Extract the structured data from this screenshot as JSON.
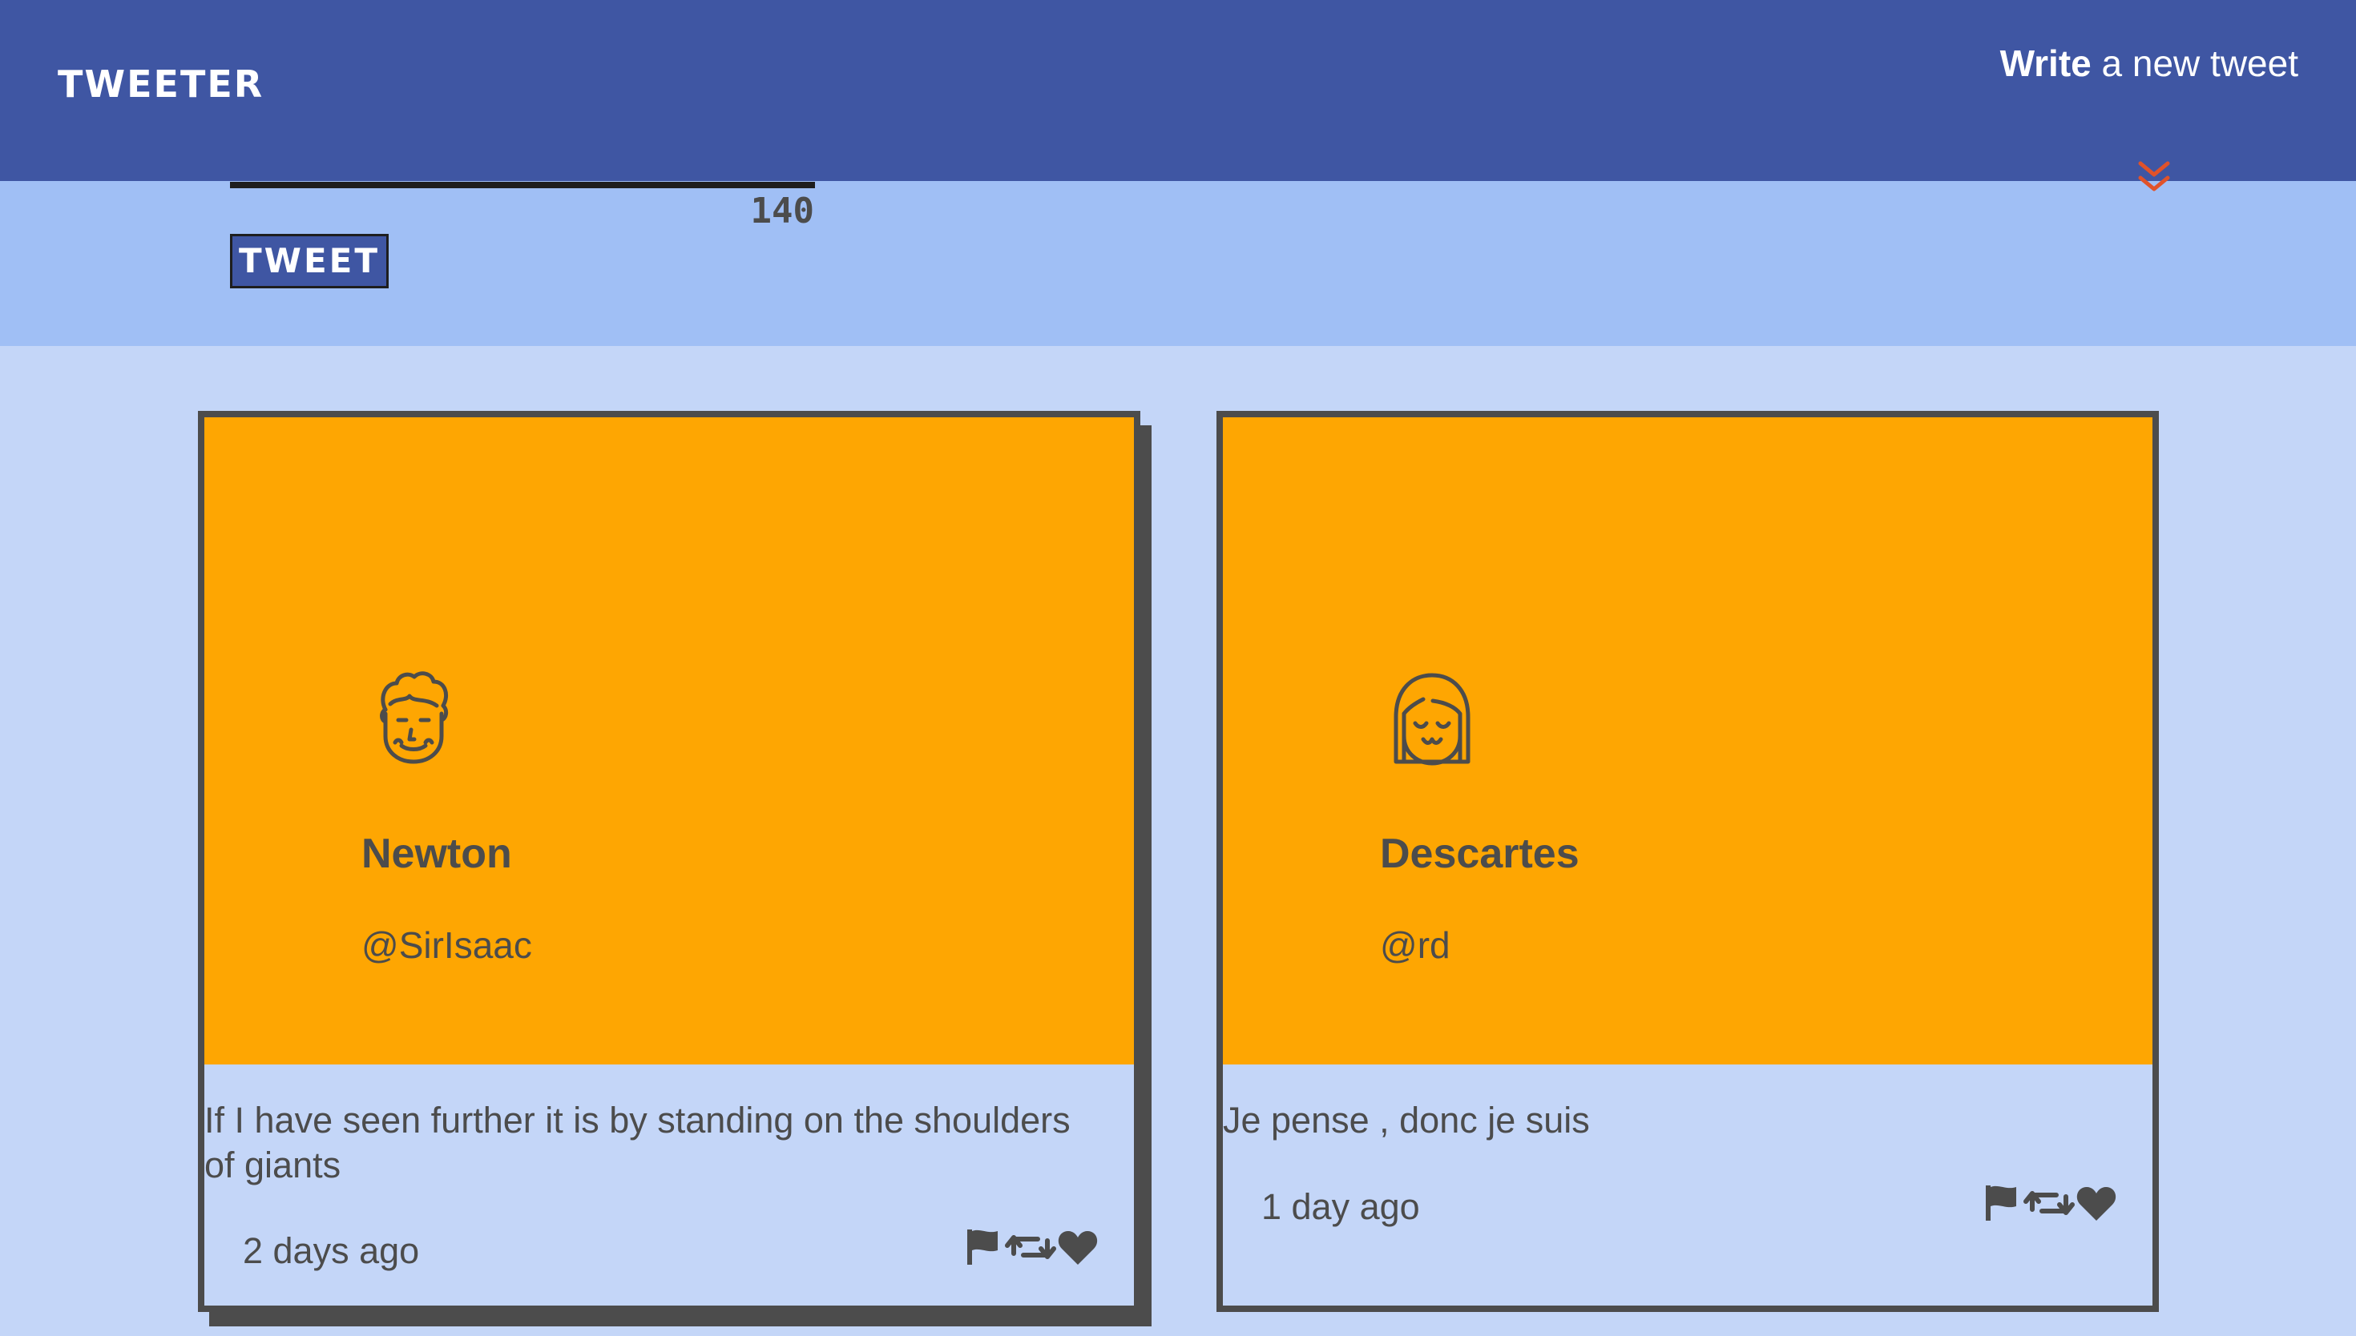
{
  "navbar": {
    "brand": "TWEETER",
    "compose_bold": "Write",
    "compose_rest": " a new tweet"
  },
  "compose": {
    "counter": "140",
    "button_label": "TWEET"
  },
  "tweets": [
    {
      "name": "Newton",
      "handle": "@SirIsaac",
      "content": "If I have seen further it is by standing on the shoulders of giants",
      "time": "2 days ago",
      "avatar_icon": "curly-hair-face-icon"
    },
    {
      "name": "Descartes",
      "handle": "@rd",
      "content": "Je pense , donc je suis",
      "time": "1 day ago",
      "avatar_icon": "bob-hair-face-icon"
    }
  ],
  "colors": {
    "navbar": "#3f56a3",
    "compose_panel": "#a0bff5",
    "page_background": "#c4d6f8",
    "card_header": "#fea602",
    "text": "#4c4c4c",
    "chevron": "#e0522a"
  }
}
